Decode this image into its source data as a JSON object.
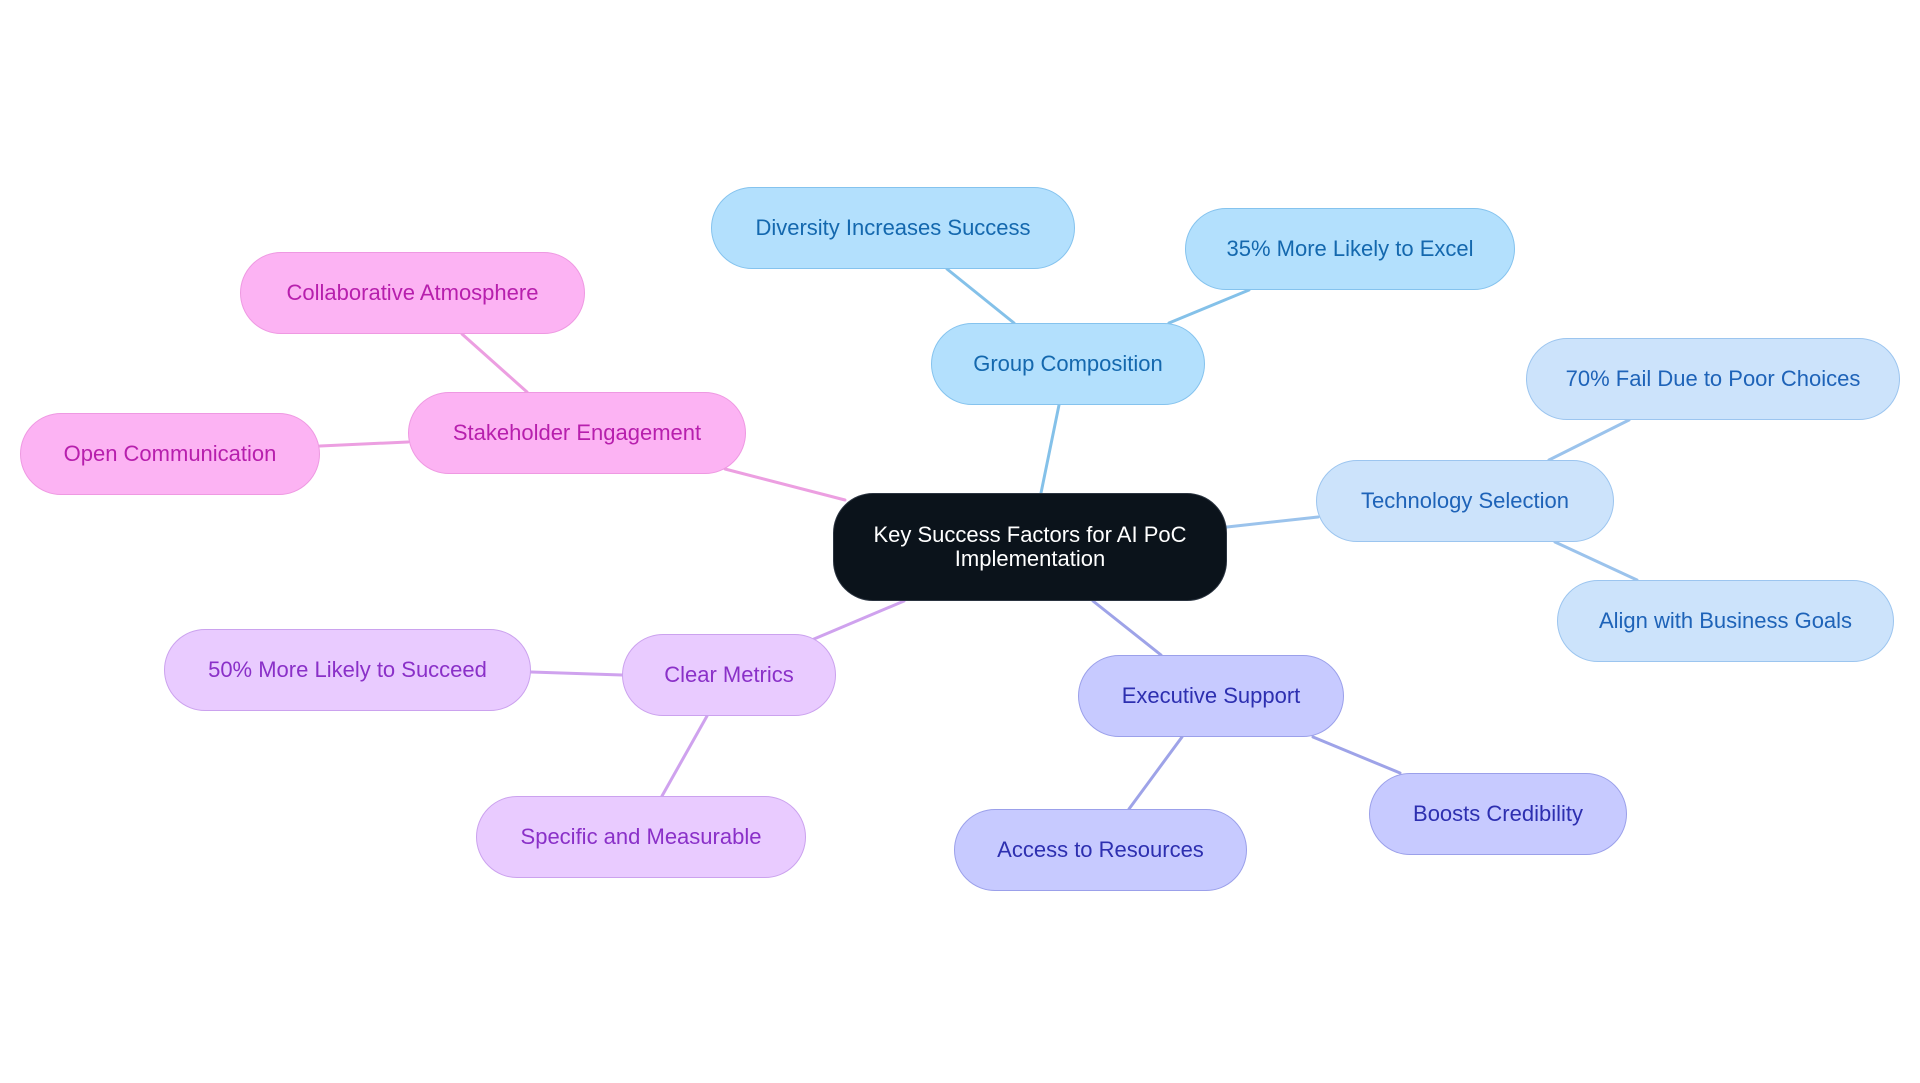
{
  "title": "Key Success Factors for AI PoC Implementation",
  "palette": {
    "root": {
      "fill": "#0b131b",
      "stroke": "#2b3440",
      "text": "#ffffff"
    },
    "group": {
      "fill": "#b3e0fd",
      "stroke": "#85c3ee",
      "text": "#1468ae",
      "edge": "#84c1e9"
    },
    "tech": {
      "fill": "#cce3fb",
      "stroke": "#9cc5ef",
      "text": "#1e63b8",
      "edge": "#9bc3ec"
    },
    "exec": {
      "fill": "#c7caff",
      "stroke": "#9ba0ea",
      "text": "#2d2fb0",
      "edge": "#9ea3e8"
    },
    "metrics": {
      "fill": "#e9cbff",
      "stroke": "#cba2ee",
      "text": "#8a30c8",
      "edge": "#cfa2ee"
    },
    "stake": {
      "fill": "#fcb3f3",
      "stroke": "#ee99e2",
      "text": "#b71fad",
      "edge": "#ec9fe1"
    }
  },
  "nodes": [
    {
      "id": "root",
      "label": "Key Success Factors for AI PoC Implementation",
      "group": "root",
      "parent": null
    },
    {
      "id": "group-composition",
      "label": "Group Composition",
      "group": "group",
      "parent": "root"
    },
    {
      "id": "diversity",
      "label": "Diversity Increases Success",
      "group": "group",
      "parent": "group-composition"
    },
    {
      "id": "excel",
      "label": "35% More Likely to Excel",
      "group": "group",
      "parent": "group-composition"
    },
    {
      "id": "technology-selection",
      "label": "Technology Selection",
      "group": "tech",
      "parent": "root"
    },
    {
      "id": "fail",
      "label": "70% Fail Due to Poor Choices",
      "group": "tech",
      "parent": "technology-selection"
    },
    {
      "id": "align",
      "label": "Align with Business Goals",
      "group": "tech",
      "parent": "technology-selection"
    },
    {
      "id": "executive-support",
      "label": "Executive Support",
      "group": "exec",
      "parent": "root"
    },
    {
      "id": "access",
      "label": "Access to Resources",
      "group": "exec",
      "parent": "executive-support"
    },
    {
      "id": "credibility",
      "label": "Boosts Credibility",
      "group": "exec",
      "parent": "executive-support"
    },
    {
      "id": "clear-metrics",
      "label": "Clear Metrics",
      "group": "metrics",
      "parent": "root"
    },
    {
      "id": "succeed",
      "label": "50% More Likely to Succeed",
      "group": "metrics",
      "parent": "clear-metrics"
    },
    {
      "id": "specific",
      "label": "Specific and Measurable",
      "group": "metrics",
      "parent": "clear-metrics"
    },
    {
      "id": "stakeholder-engagement",
      "label": "Stakeholder Engagement",
      "group": "stake",
      "parent": "root"
    },
    {
      "id": "collaborative",
      "label": "Collaborative Atmosphere",
      "group": "stake",
      "parent": "stakeholder-engagement"
    },
    {
      "id": "open-communication",
      "label": "Open Communication",
      "group": "stake",
      "parent": "stakeholder-engagement"
    }
  ]
}
